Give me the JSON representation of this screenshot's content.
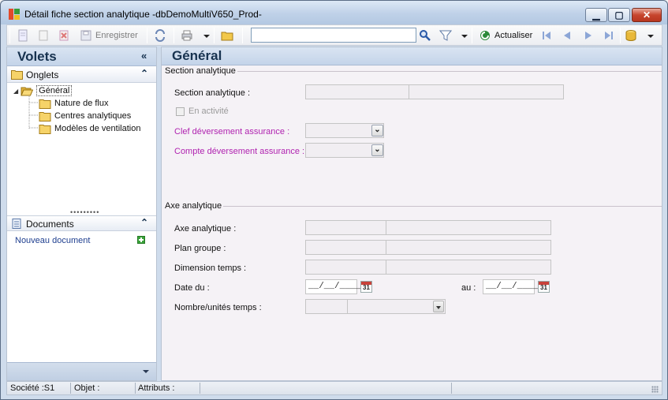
{
  "window": {
    "title": "Détail fiche section analytique -dbDemoMultiV650_Prod-",
    "min_glyph": "▁",
    "max_glyph": "▢",
    "close_glyph": "✕"
  },
  "toolbar": {
    "save_label": "Enregistrer",
    "search_value": "",
    "refresh_label": "Actualiser"
  },
  "left_panel": {
    "title": "Volets",
    "collapse_glyph": "«",
    "onglets": {
      "title": "Onglets",
      "toggle_glyph": "≈",
      "items": [
        {
          "label": "Général",
          "selected": true,
          "level": 0
        },
        {
          "label": "Nature de flux",
          "level": 1
        },
        {
          "label": "Centres analytiques",
          "level": 1
        },
        {
          "label": "Modèles de ventilation",
          "level": 1
        }
      ]
    },
    "splitter": "•••••••••",
    "documents": {
      "title": "Documents",
      "toggle_glyph": "≈",
      "new_doc": "Nouveau document"
    }
  },
  "main": {
    "title": "Général",
    "section_analytique": {
      "group_title": "Section analytique",
      "section_label": "Section analytique :",
      "en_activite_label": "En activité",
      "clef_label": "Clef déversement assurance :",
      "compte_label": "Compte déversement assurance :"
    },
    "axe_analytique": {
      "group_title": "Axe analytique",
      "axe_label": "Axe analytique :",
      "plan_label": "Plan groupe :",
      "dimension_label": "Dimension temps :",
      "date_du_label": "Date du :",
      "date_du_value": "__/__/____",
      "au_label": "au :",
      "date_au_value": "__/__/____",
      "calendar_day": "31",
      "nombre_label": "Nombre/unités temps :"
    }
  },
  "statusbar": {
    "societe": "Société :S1",
    "objet": "Objet :",
    "attributs": "Attributs :"
  }
}
